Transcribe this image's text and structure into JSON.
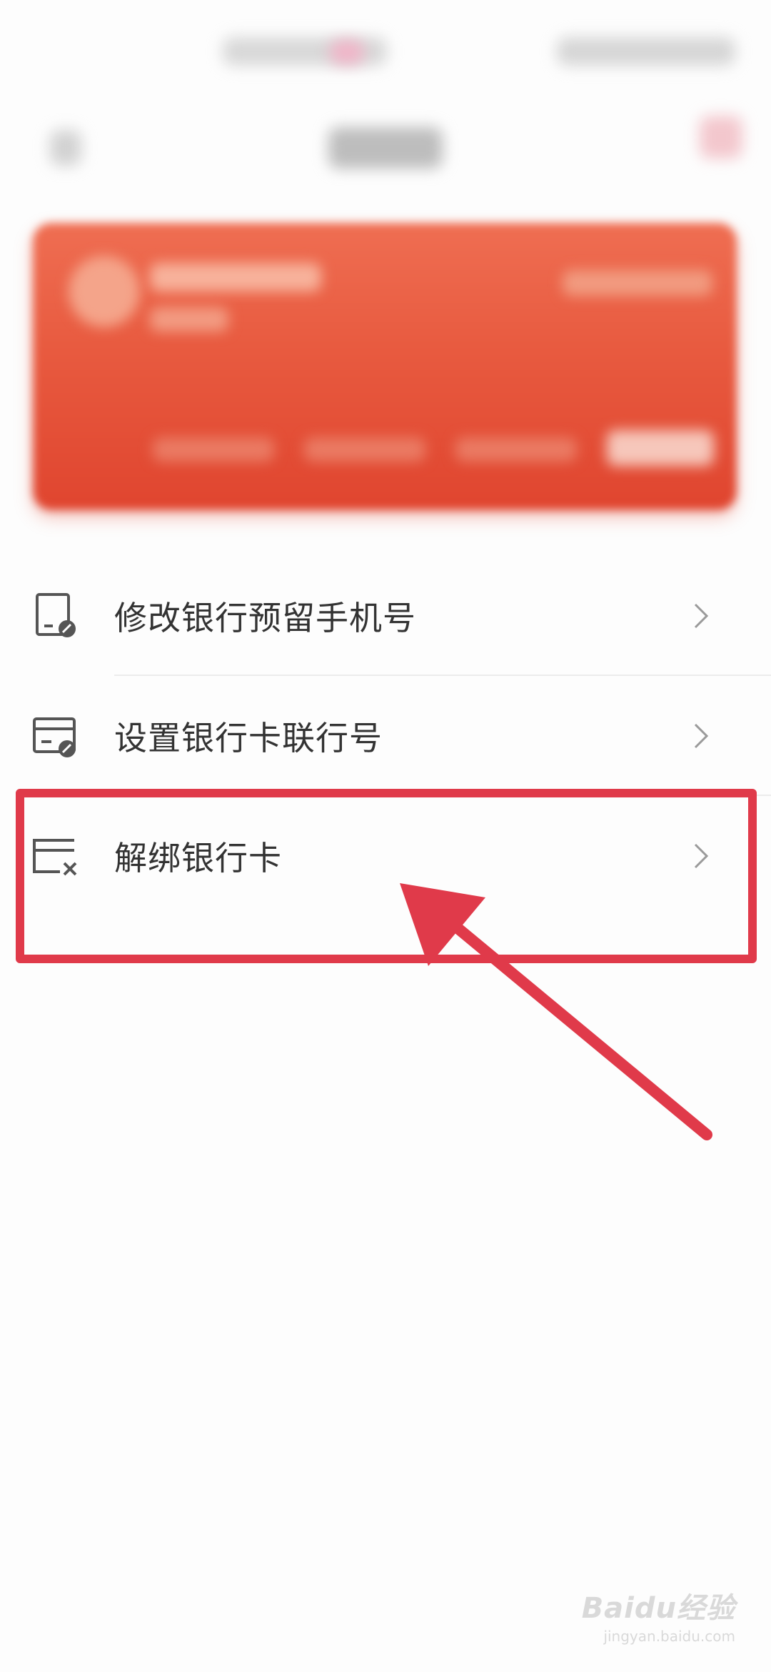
{
  "menu": {
    "items": [
      {
        "label": "修改银行预留手机号",
        "icon": "phone-edit-icon"
      },
      {
        "label": "设置银行卡联行号",
        "icon": "card-settings-icon"
      },
      {
        "label": "解绑银行卡",
        "icon": "card-unbind-icon"
      }
    ]
  },
  "annotation": {
    "color": "#e03a4a",
    "highlighted_item": "解绑银行卡"
  },
  "card": {
    "color": "#e85a3f"
  },
  "watermark": {
    "main": "Baidu经验",
    "sub": "jingyan.baidu.com"
  }
}
